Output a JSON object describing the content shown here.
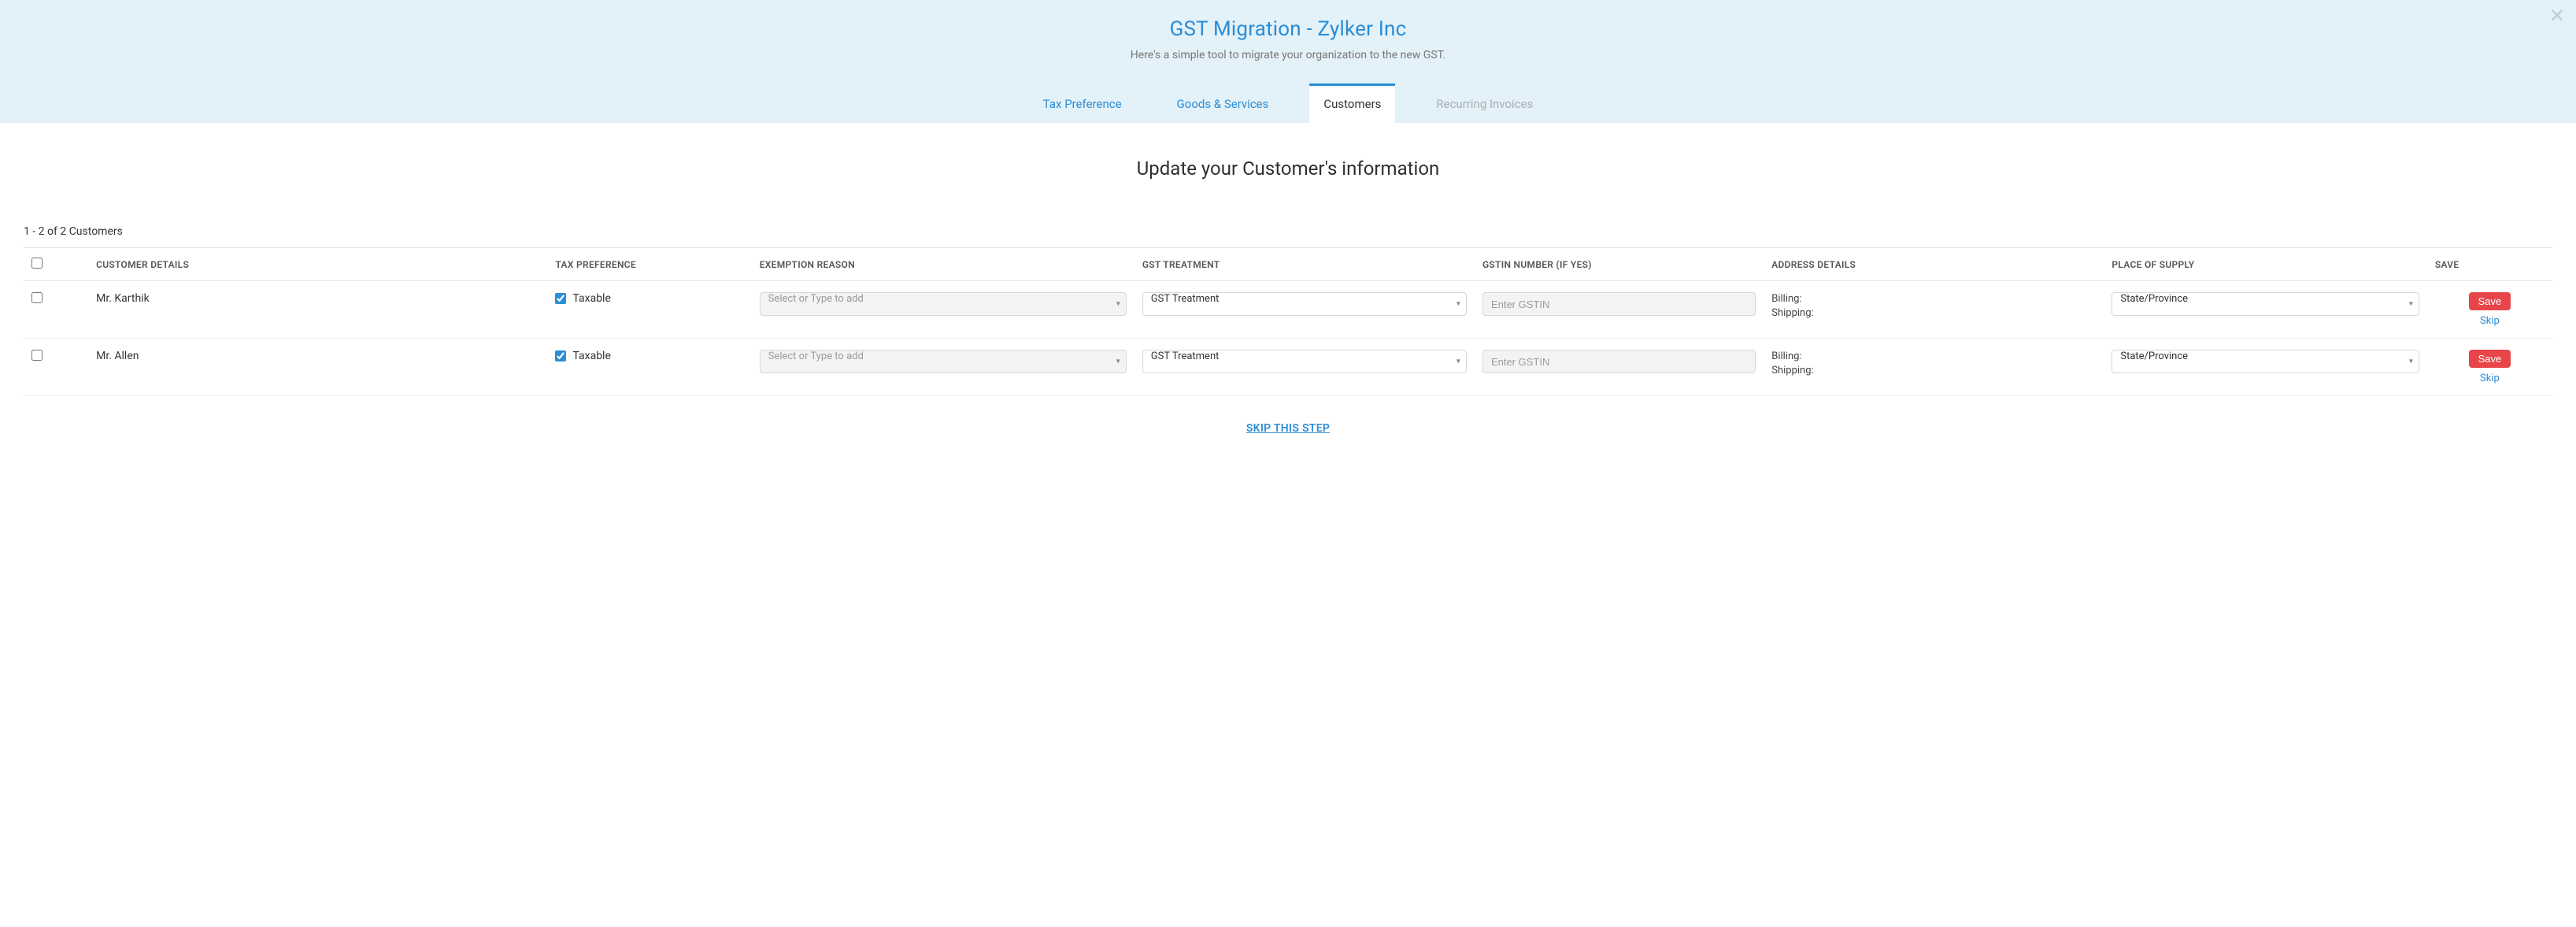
{
  "header": {
    "title": "GST Migration - Zylker Inc",
    "subtitle": "Here's a simple tool to migrate your organization to the new GST."
  },
  "tabs": [
    {
      "label": "Tax Preference",
      "state": "link"
    },
    {
      "label": "Goods & Services",
      "state": "link"
    },
    {
      "label": "Customers",
      "state": "active"
    },
    {
      "label": "Recurring Invoices",
      "state": "disabled"
    }
  ],
  "section_title": "Update your Customer's information",
  "count_text": "1 - 2 of 2 Customers",
  "columns": {
    "name": "CUSTOMER DETAILS",
    "preference": "TAX PREFERENCE",
    "exemption": "EXEMPTION REASON",
    "treatment": "GST TREATMENT",
    "gstin": "GSTIN NUMBER (IF YES)",
    "address": "ADDRESS DETAILS",
    "place": "PLACE OF SUPPLY",
    "save": "SAVE"
  },
  "placeholders": {
    "exemption": "Select or Type to add",
    "treatment": "GST Treatment",
    "gstin": "Enter GSTIN",
    "place": "State/Province"
  },
  "address_labels": {
    "billing": "Billing:",
    "shipping": "Shipping:"
  },
  "row_actions": {
    "save": "Save",
    "skip": "Skip"
  },
  "customers": [
    {
      "name": "Mr. Karthik",
      "taxable_label": "Taxable",
      "taxable_checked": true
    },
    {
      "name": "Mr. Allen",
      "taxable_label": "Taxable",
      "taxable_checked": true
    }
  ],
  "skip_step": "SKIP THIS STEP"
}
